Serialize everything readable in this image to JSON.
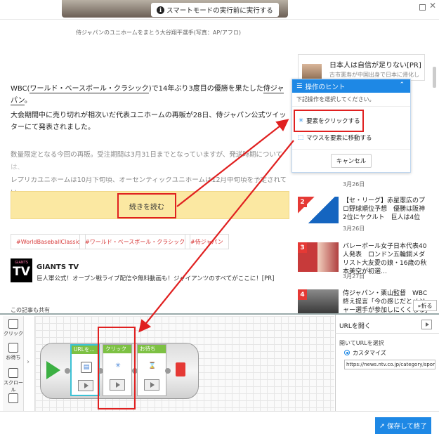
{
  "topbar": {
    "hint": "スマートモードの実行前に実行する"
  },
  "article": {
    "caption": "侍ジャパンのユニホームをまとう大谷翔平選手(写真：AP/アフロ)",
    "p1_pre": "WBC(",
    "p1_link1": "ワールド・ベースボール・クラシック",
    "p1_mid": ")で14年ぶり3度目の優勝を果たした",
    "p1_link2": "侍ジャパン",
    "p1_post": "。",
    "p2": "大会期間中に売り切れが相次いだ代表ユニホームの再販が28日、侍ジャパン公式ツイッターにて発表されました。",
    "p3a": "数量限定となる今回の再販。受注期間は3月31日までとなっていますが、発送時期については、",
    "p3b": "レプリカユニホームは10月下旬頃、オーセンティックユニホームは12月中旬頃を予定されてい",
    "read_more": "続きを読む",
    "tags": [
      "#WorldBaseballClassic",
      "#ワールド・ベースボール・クラシック",
      "#侍ジャパン"
    ],
    "tv_logo_small": "GIANTS",
    "tv_logo_big": "TV",
    "tv_title": "GIANTS TV",
    "tv_desc": "巨人軍公式！オープン戦ライブ配信や無料動画も！ジャイアンツのすべてがここに！[PR]",
    "small_text": "この記事も共有"
  },
  "sidebar": {
    "pr_title": "日本人は自信が足りない[PR]",
    "pr_sub": "古市憲寿が中国出身で日本に帰化した",
    "date_top": "3月26日",
    "news": [
      {
        "rank": "2",
        "title": "【セ・リーグ】赤星憲広のプロ野球順位予想　優勝は阪神　2位にヤクルト　巨人は4位",
        "date": "3月26日"
      },
      {
        "rank": "3",
        "title": "バレーボール女子日本代表40人発表　ロンドン五輪銅メダリスト大友愛の娘・16歳の秋本美空が初選…",
        "date": "3月27日"
      },
      {
        "rank": "4",
        "title": "侍ジャパン・栗山監督　WBC終え提言「今の感じだとメジャー選手が参加しにくくなる」",
        "date": ""
      }
    ],
    "fold_label": "折る"
  },
  "popup": {
    "title": "操作のヒント",
    "subtitle": "下記操作を選択してください。",
    "option1": "要素をクリックする",
    "option2": "マウスを要素に移動する",
    "cancel": "キャンセル"
  },
  "toolbox": {
    "items": [
      "クリック",
      "お待ち",
      "スクロール"
    ]
  },
  "workflow": {
    "nodes": [
      {
        "label": "URLを…",
        "icon": "url-open-icon"
      },
      {
        "label": "クリック",
        "icon": "click-icon"
      },
      {
        "label": "お待ち",
        "icon": "hourglass-icon"
      }
    ]
  },
  "properties": {
    "title": "URLを開く",
    "section_label": "開いてURLを選択",
    "radio_label": "カスタマイズ",
    "url_value": "https://news.ntv.co.jp/category/sports/"
  },
  "footer": {
    "save_label": "保存して終了"
  },
  "colors": {
    "accent": "#1e88e5",
    "annotation": "#e02020",
    "start": "#3cb043",
    "stop": "#e53935",
    "node_head": "#7dc143"
  }
}
